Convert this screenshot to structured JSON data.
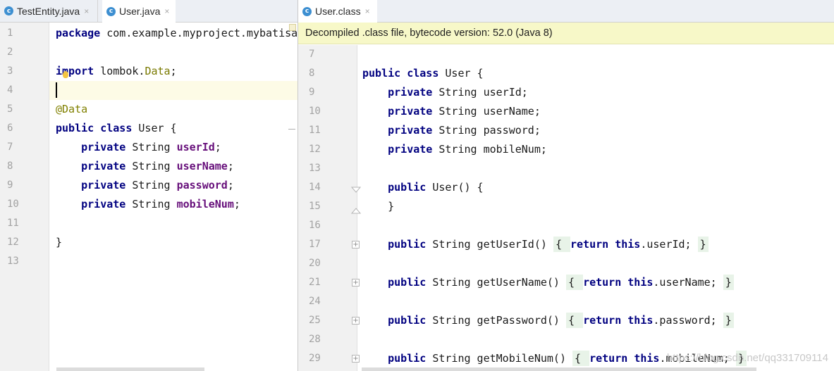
{
  "left_tabs": [
    {
      "icon": "c",
      "label": "TestEntity.java",
      "close": "×"
    },
    {
      "icon": "c",
      "label": "User.java",
      "close": "×"
    }
  ],
  "right_tabs": [
    {
      "icon": "c",
      "label": "User.class",
      "close": "×"
    }
  ],
  "banner": "Decompiled .class file, bytecode version: 52.0 (Java 8)",
  "left_editor": {
    "lines": [
      {
        "n": "1",
        "parts": [
          {
            "t": "package",
            "c": "kw"
          },
          {
            "t": " com.example.myproject.mybatisa",
            "c": ""
          }
        ]
      },
      {
        "n": "2",
        "parts": []
      },
      {
        "n": "3",
        "parts": [
          {
            "t": "import",
            "c": "kw"
          },
          {
            "t": " lombok.",
            "c": ""
          },
          {
            "t": "Data",
            "c": "imp"
          },
          {
            "t": ";",
            "c": ""
          }
        ]
      },
      {
        "n": "4",
        "parts": []
      },
      {
        "n": "5",
        "parts": [
          {
            "t": "@Data",
            "c": "ann"
          }
        ]
      },
      {
        "n": "6",
        "parts": [
          {
            "t": "public",
            "c": "kw"
          },
          {
            "t": " ",
            "c": ""
          },
          {
            "t": "class",
            "c": "kw"
          },
          {
            "t": " User {",
            "c": ""
          }
        ]
      },
      {
        "n": "7",
        "parts": [
          {
            "t": "    ",
            "c": ""
          },
          {
            "t": "private",
            "c": "kw"
          },
          {
            "t": " String ",
            "c": ""
          },
          {
            "t": "userId",
            "c": "fld"
          },
          {
            "t": ";",
            "c": ""
          }
        ]
      },
      {
        "n": "8",
        "parts": [
          {
            "t": "    ",
            "c": ""
          },
          {
            "t": "private",
            "c": "kw"
          },
          {
            "t": " String ",
            "c": ""
          },
          {
            "t": "userName",
            "c": "fld"
          },
          {
            "t": ";",
            "c": ""
          }
        ]
      },
      {
        "n": "9",
        "parts": [
          {
            "t": "    ",
            "c": ""
          },
          {
            "t": "private",
            "c": "kw"
          },
          {
            "t": " String ",
            "c": ""
          },
          {
            "t": "password",
            "c": "fld"
          },
          {
            "t": ";",
            "c": ""
          }
        ]
      },
      {
        "n": "10",
        "parts": [
          {
            "t": "    ",
            "c": ""
          },
          {
            "t": "private",
            "c": "kw"
          },
          {
            "t": " String ",
            "c": ""
          },
          {
            "t": "mobileNum",
            "c": "fld"
          },
          {
            "t": ";",
            "c": ""
          }
        ]
      },
      {
        "n": "11",
        "parts": []
      },
      {
        "n": "12",
        "parts": [
          {
            "t": "}",
            "c": ""
          }
        ]
      },
      {
        "n": "13",
        "parts": []
      }
    ]
  },
  "right_editor": {
    "lines": [
      {
        "n": "7",
        "parts": []
      },
      {
        "n": "8",
        "parts": [
          {
            "t": "public",
            "c": "kw"
          },
          {
            "t": " ",
            "c": ""
          },
          {
            "t": "class",
            "c": "kw"
          },
          {
            "t": " User {",
            "c": ""
          }
        ]
      },
      {
        "n": "9",
        "parts": [
          {
            "t": "    ",
            "c": ""
          },
          {
            "t": "private",
            "c": "kw"
          },
          {
            "t": " String userId;",
            "c": ""
          }
        ]
      },
      {
        "n": "10",
        "parts": [
          {
            "t": "    ",
            "c": ""
          },
          {
            "t": "private",
            "c": "kw"
          },
          {
            "t": " String userName;",
            "c": ""
          }
        ]
      },
      {
        "n": "11",
        "parts": [
          {
            "t": "    ",
            "c": ""
          },
          {
            "t": "private",
            "c": "kw"
          },
          {
            "t": " String password;",
            "c": ""
          }
        ]
      },
      {
        "n": "12",
        "parts": [
          {
            "t": "    ",
            "c": ""
          },
          {
            "t": "private",
            "c": "kw"
          },
          {
            "t": " String mobileNum;",
            "c": ""
          }
        ]
      },
      {
        "n": "13",
        "parts": []
      },
      {
        "n": "14",
        "parts": [
          {
            "t": "    ",
            "c": ""
          },
          {
            "t": "public",
            "c": "kw"
          },
          {
            "t": " User() {",
            "c": ""
          }
        ]
      },
      {
        "n": "15",
        "parts": [
          {
            "t": "    }",
            "c": ""
          }
        ]
      },
      {
        "n": "16",
        "parts": []
      },
      {
        "n": "17",
        "parts": [
          {
            "t": "    ",
            "c": ""
          },
          {
            "t": "public",
            "c": "kw"
          },
          {
            "t": " String getUserId() ",
            "c": ""
          },
          {
            "t": "{ ",
            "c": "brace-open"
          },
          {
            "t": "return",
            "c": "kw"
          },
          {
            "t": " ",
            "c": ""
          },
          {
            "t": "this",
            "c": "kw"
          },
          {
            "t": ".userId; ",
            "c": ""
          },
          {
            "t": "}",
            "c": "brace-close"
          }
        ]
      },
      {
        "n": "20",
        "parts": []
      },
      {
        "n": "21",
        "parts": [
          {
            "t": "    ",
            "c": ""
          },
          {
            "t": "public",
            "c": "kw"
          },
          {
            "t": " String getUserName() ",
            "c": ""
          },
          {
            "t": "{ ",
            "c": "brace-open"
          },
          {
            "t": "return",
            "c": "kw"
          },
          {
            "t": " ",
            "c": ""
          },
          {
            "t": "this",
            "c": "kw"
          },
          {
            "t": ".userName; ",
            "c": ""
          },
          {
            "t": "}",
            "c": "brace-close"
          }
        ]
      },
      {
        "n": "24",
        "parts": []
      },
      {
        "n": "25",
        "parts": [
          {
            "t": "    ",
            "c": ""
          },
          {
            "t": "public",
            "c": "kw"
          },
          {
            "t": " String getPassword() ",
            "c": ""
          },
          {
            "t": "{ ",
            "c": "brace-open"
          },
          {
            "t": "return",
            "c": "kw"
          },
          {
            "t": " ",
            "c": ""
          },
          {
            "t": "this",
            "c": "kw"
          },
          {
            "t": ".password; ",
            "c": ""
          },
          {
            "t": "}",
            "c": "brace-close"
          }
        ]
      },
      {
        "n": "28",
        "parts": []
      },
      {
        "n": "29",
        "parts": [
          {
            "t": "    ",
            "c": ""
          },
          {
            "t": "public",
            "c": "kw"
          },
          {
            "t": " String getMobileNum() ",
            "c": ""
          },
          {
            "t": "{ ",
            "c": "brace-open"
          },
          {
            "t": "return",
            "c": "kw"
          },
          {
            "t": " ",
            "c": ""
          },
          {
            "t": "this",
            "c": "kw"
          },
          {
            "t": ".mobileNum; ",
            "c": ""
          },
          {
            "t": "}",
            "c": "brace-close"
          }
        ]
      }
    ]
  },
  "watermark": "https://blog.csdn.net/qq331709114"
}
